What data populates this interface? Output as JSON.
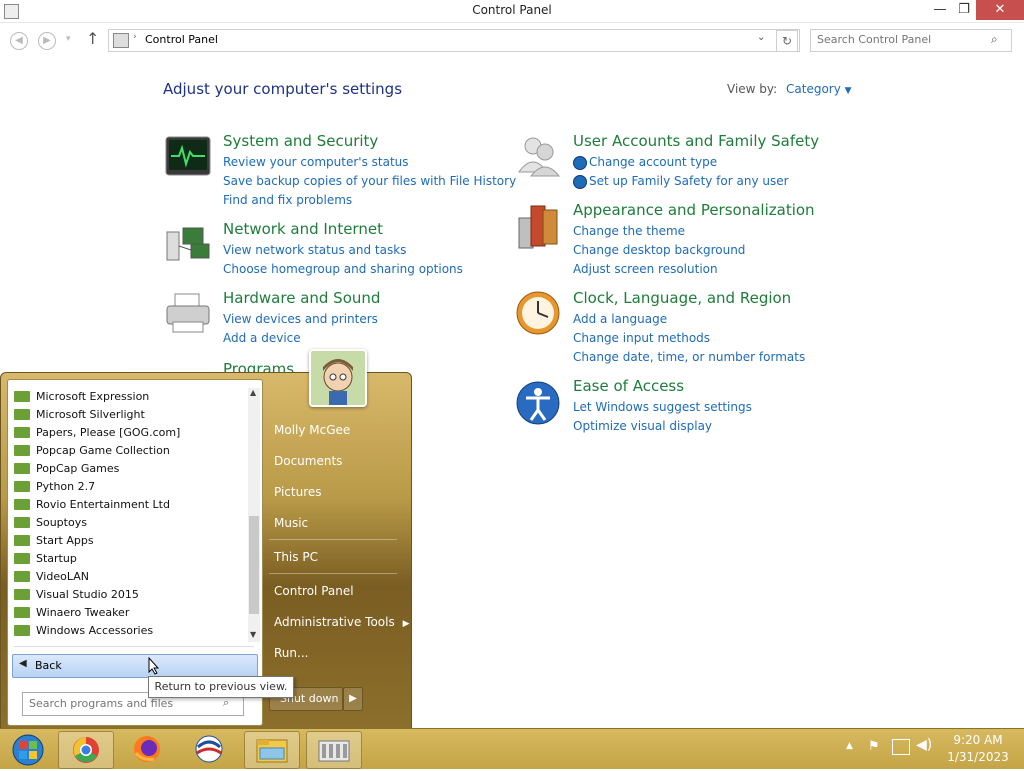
{
  "window": {
    "title": "Control Panel",
    "controls": {
      "minimize": "—",
      "maximize": "❐",
      "close": "✕"
    }
  },
  "address": {
    "breadcrumb": "Control Panel",
    "search_placeholder": "Search Control Panel"
  },
  "main": {
    "heading": "Adjust your computer's settings",
    "view_by_label": "View by:",
    "view_by_value": "Category",
    "categories": [
      {
        "title": "System and Security",
        "icon": "system-security-icon",
        "links": [
          "Review your computer's status",
          "Save backup copies of your files with File History",
          "Find and fix problems"
        ]
      },
      {
        "title": "Network and Internet",
        "icon": "network-icon",
        "links": [
          "View network status and tasks",
          "Choose homegroup and sharing options"
        ]
      },
      {
        "title": "Hardware and Sound",
        "icon": "printer-icon",
        "links": [
          "View devices and printers",
          "Add a device"
        ]
      },
      {
        "title": "Programs",
        "icon": "programs-icon",
        "links": []
      },
      {
        "title": "User Accounts and Family Safety",
        "icon": "users-icon",
        "links": [
          "Change account type",
          "Set up Family Safety for any user"
        ]
      },
      {
        "title": "Appearance and Personalization",
        "icon": "appearance-icon",
        "links": [
          "Change the theme",
          "Change desktop background",
          "Adjust screen resolution"
        ]
      },
      {
        "title": "Clock, Language, and Region",
        "icon": "clock-icon",
        "links": [
          "Add a language",
          "Change input methods",
          "Change date, time, or number formats"
        ]
      },
      {
        "title": "Ease of Access",
        "icon": "ease-of-access-icon",
        "links": [
          "Let Windows suggest settings",
          "Optimize visual display"
        ]
      }
    ]
  },
  "start_menu": {
    "programs": [
      "Microsoft Expression",
      "Microsoft Silverlight",
      "Papers, Please [GOG.com]",
      "Popcap Game Collection",
      "PopCap Games",
      "Python 2.7",
      "Rovio Entertainment Ltd",
      "Souptoys",
      "Start Apps",
      "Startup",
      "VideoLAN",
      "Visual Studio 2015",
      "Winaero Tweaker",
      "Windows Accessories"
    ],
    "back_label": "Back",
    "search_placeholder": "Search programs and files",
    "right_links": [
      "Molly McGee",
      "Documents",
      "Pictures",
      "Music",
      "This PC",
      "Control Panel",
      "Administrative Tools",
      "Run..."
    ],
    "shutdown_label": "Shut down",
    "tooltip": "Return to previous view."
  },
  "taskbar": {
    "apps": [
      "start-orb-icon",
      "chrome-icon",
      "firefox-icon",
      "app-icon",
      "file-explorer-icon",
      "control-panel-icon"
    ],
    "time": "9:20 AM",
    "date": "1/31/2023"
  },
  "colors": {
    "category_title": "#1e7d3a",
    "link": "#1e6bb8",
    "heading": "#1e3287",
    "taskbar": "#c9a94c"
  }
}
